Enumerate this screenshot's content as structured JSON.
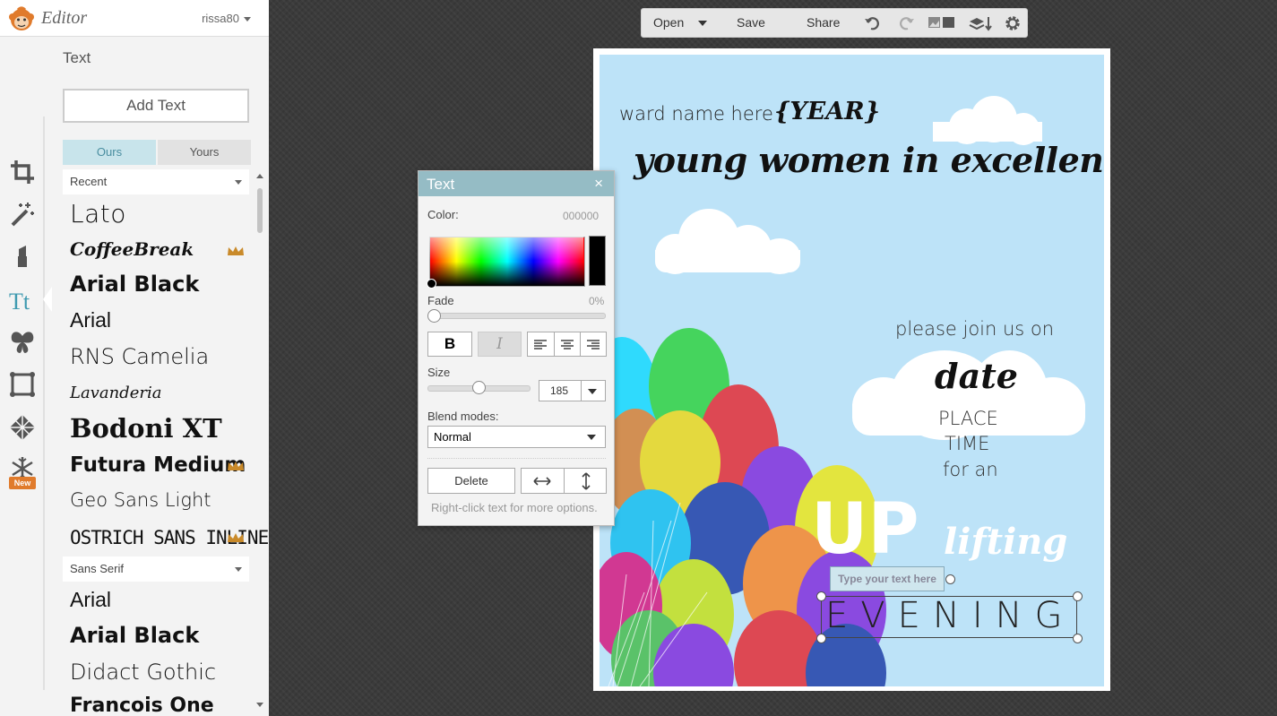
{
  "app": {
    "title": "Editor",
    "user": "rissa80"
  },
  "toolbar": {
    "open": "Open",
    "save": "Save",
    "share": "Share"
  },
  "panel": {
    "title": "Text",
    "add_text": "Add Text",
    "tabs": {
      "ours": "Ours",
      "yours": "Yours"
    },
    "group_recent": "Recent",
    "group_sans": "Sans Serif",
    "new_badge": "New",
    "fonts_recent": [
      "Lato",
      "CoffeeBreak",
      "Arial Black",
      "Arial",
      "RNS Camelia",
      "Lavanderia",
      "Bodoni XT",
      "Futura Medium",
      "Geo Sans Light",
      "OSTRICH SANS INLINE"
    ],
    "fonts_sans": [
      "Arial",
      "Arial Black",
      "Didact Gothic",
      "Francois One"
    ]
  },
  "dialog": {
    "title": "Text",
    "close": "×",
    "color_label": "Color:",
    "color_value": "000000",
    "fade_label": "Fade",
    "fade_value": "0%",
    "fade_fraction": 0,
    "bold": "B",
    "italic": "I",
    "size_label": "Size",
    "size_value": "185",
    "blend_label": "Blend modes:",
    "blend_value": "Normal",
    "delete": "Delete",
    "hint": "Right-click text for more options."
  },
  "canvas": {
    "line1": "ward name here",
    "year": "{YEAR}",
    "line2": "young women in excellence",
    "join": "please join us on",
    "date": "date",
    "place": "PLACE",
    "time": "TIME",
    "for_an": "for an",
    "up": "UP",
    "lifting": "lifting",
    "placeholder": "Type your text here",
    "evening": "EVENING"
  },
  "colors": {
    "accent": "#3f9ab0",
    "dialog_header": "#95bcc5",
    "canvas_bg": "#bde3f8",
    "crown": "#c98a2a",
    "new_badge": "#e07b2c"
  }
}
